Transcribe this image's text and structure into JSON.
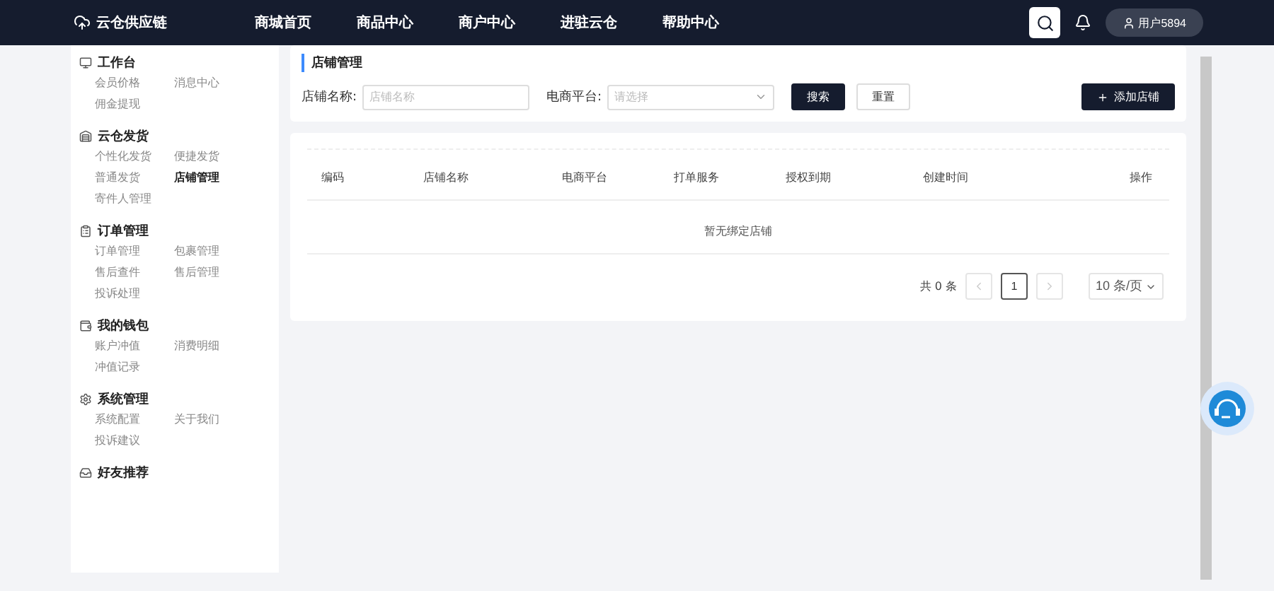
{
  "navbar": {
    "logo": "云仓供应链",
    "links": [
      "商城首页",
      "商品中心",
      "商户中心",
      "进驻云仓",
      "帮助中心"
    ],
    "user": "用户5894"
  },
  "sidebar": {
    "groups": [
      {
        "title": "工作台",
        "items": [
          {
            "label": "会员价格",
            "selected": false
          },
          {
            "label": "消息中心",
            "selected": false
          },
          {
            "label": "佣金提现",
            "selected": false
          }
        ]
      },
      {
        "title": "云仓发货",
        "items": [
          {
            "label": "个性化发货",
            "selected": false
          },
          {
            "label": "便捷发货",
            "selected": false
          },
          {
            "label": "普通发货",
            "selected": false
          },
          {
            "label": "店铺管理",
            "selected": true
          },
          {
            "label": "寄件人管理",
            "selected": false
          }
        ]
      },
      {
        "title": "订单管理",
        "items": [
          {
            "label": "订单管理",
            "selected": false
          },
          {
            "label": "包裹管理",
            "selected": false
          },
          {
            "label": "售后查件",
            "selected": false
          },
          {
            "label": "售后管理",
            "selected": false
          },
          {
            "label": "投诉处理",
            "selected": false
          }
        ]
      },
      {
        "title": "我的钱包",
        "items": [
          {
            "label": "账户冲值",
            "selected": false
          },
          {
            "label": "消费明细",
            "selected": false
          },
          {
            "label": "冲值记录",
            "selected": false
          }
        ]
      },
      {
        "title": "系统管理",
        "items": [
          {
            "label": "系统配置",
            "selected": false
          },
          {
            "label": "关于我们",
            "selected": false
          },
          {
            "label": "投诉建议",
            "selected": false
          }
        ]
      },
      {
        "title": "好友推荐"
      }
    ]
  },
  "filter": {
    "title": "店铺管理",
    "name_label": "店铺名称:",
    "name_placeholder": "店铺名称",
    "platform_label": "电商平台:",
    "platform_placeholder": "请选择",
    "search": "搜索",
    "reset": "重置",
    "add": "添加店铺"
  },
  "table": {
    "columns": [
      "编码",
      "店铺名称",
      "电商平台",
      "打单服务",
      "授权到期",
      "创建时间",
      "操作"
    ],
    "empty": "暂无绑定店铺"
  },
  "pagination": {
    "total": "共 0 条",
    "pages": [
      {
        "label": "1",
        "selected": true
      }
    ],
    "page_size": "10 条/页"
  }
}
